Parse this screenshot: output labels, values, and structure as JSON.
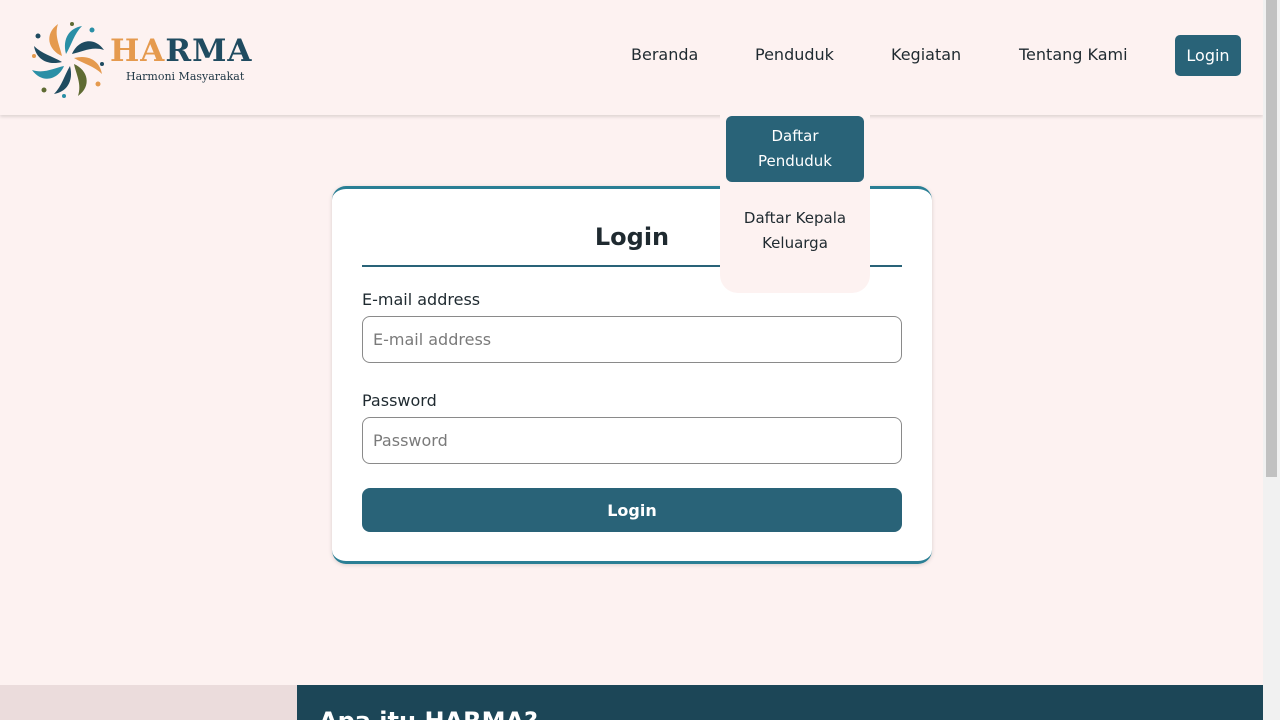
{
  "brand": {
    "name_part1": "HA",
    "name_part2": "RMA",
    "tagline": "Harmoni Masyarakat",
    "colors": {
      "orange": "#e59a4e",
      "navy": "#1f4b60",
      "teal": "#2a8fa6",
      "olive": "#5f6b33"
    }
  },
  "nav": {
    "items": [
      {
        "label": "Beranda"
      },
      {
        "label": "Penduduk"
      },
      {
        "label": "Kegiatan"
      },
      {
        "label": "Tentang Kami"
      }
    ],
    "login_label": "Login"
  },
  "dropdown": {
    "items": [
      {
        "label": "Daftar Penduduk",
        "active": true
      },
      {
        "label": "Daftar Kepala Keluarga",
        "active": false
      }
    ]
  },
  "login_form": {
    "title": "Login",
    "email_label": "E-mail address",
    "email_placeholder": "E-mail address",
    "email_value": "",
    "password_label": "Password",
    "password_placeholder": "Password",
    "password_value": "",
    "submit_label": "Login"
  },
  "footer": {
    "heading": "Apa itu HARMA?"
  },
  "theme": {
    "background": "#fdf2f1",
    "primary": "#296378",
    "footer_dark": "#1c4657"
  }
}
